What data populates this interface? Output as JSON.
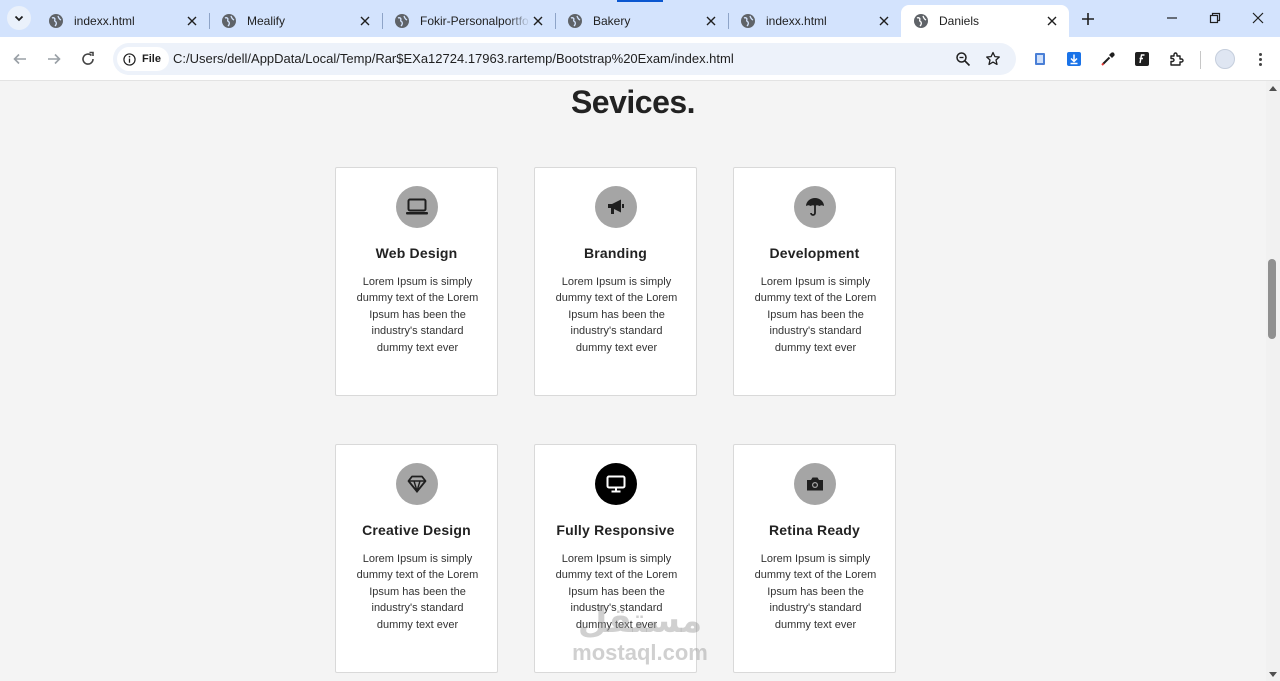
{
  "browser": {
    "tabs": [
      {
        "title": "indexx.html",
        "active": false
      },
      {
        "title": "Mealify",
        "active": false
      },
      {
        "title": "Fokir-Personalportfolio",
        "active": false
      },
      {
        "title": "Bakery",
        "active": false
      },
      {
        "title": "indexx.html",
        "active": false
      },
      {
        "title": "Daniels",
        "active": true
      }
    ],
    "site_info_label": "File",
    "url": "C:/Users/dell/AppData/Local/Temp/Rar$EXa12724.17963.rartemp/Bootstrap%20Exam/index.html",
    "colors": {
      "tabstrip": "#d3e3fd",
      "omnibox": "#edf2fa",
      "accent": "#0b57d0"
    }
  },
  "page": {
    "heading": "Sevices.",
    "services": [
      {
        "icon": "laptop-icon",
        "title": "Web Design",
        "description": "Lorem Ipsum is simply dummy text of the Lorem Ipsum has been the industry's standard dummy text ever"
      },
      {
        "icon": "megaphone-icon",
        "title": "Branding",
        "description": "Lorem Ipsum is simply dummy text of the Lorem Ipsum has been the industry's standard dummy text ever"
      },
      {
        "icon": "umbrella-icon",
        "title": "Development",
        "description": "Lorem Ipsum is simply dummy text of the Lorem Ipsum has been the industry's standard dummy text ever"
      },
      {
        "icon": "diamond-icon",
        "title": "Creative Design",
        "description": "Lorem Ipsum is simply dummy text of the Lorem Ipsum has been the industry's standard dummy text ever"
      },
      {
        "icon": "desktop-icon",
        "title": "Fully Responsive",
        "description": "Lorem Ipsum is simply dummy text of the Lorem Ipsum has been the industry's standard dummy text ever",
        "highlighted": true
      },
      {
        "icon": "camera-icon",
        "title": "Retina Ready",
        "description": "Lorem Ipsum is simply dummy text of the Lorem Ipsum has been the industry's standard dummy text ever"
      }
    ],
    "watermark": {
      "arabic": "مستقل",
      "latin": "mostaql.com"
    }
  }
}
